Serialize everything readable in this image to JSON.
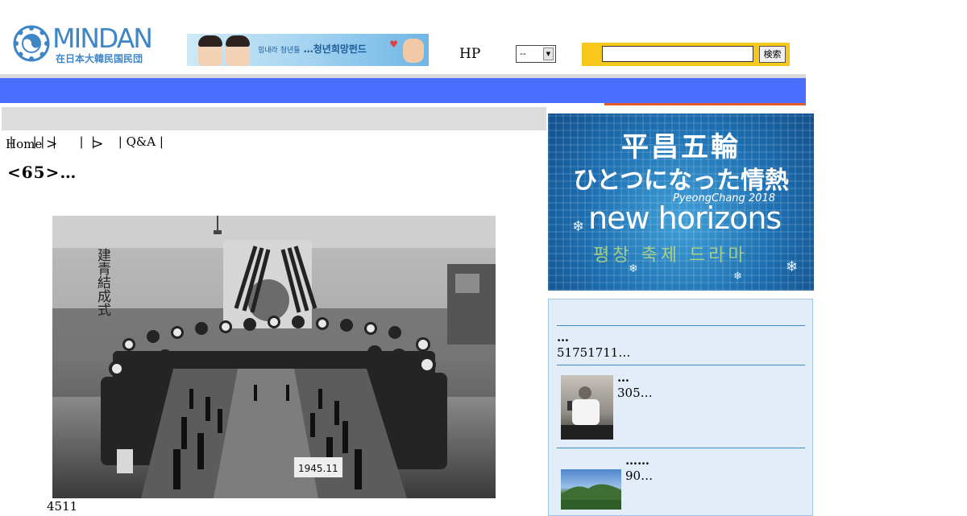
{
  "header": {
    "logo_text": "MINDAN",
    "logo_subtext": "在日本大韓民国民団",
    "banner_slogan_small": "힘내라 청년들",
    "banner_slogan": "…청년희망펀드",
    "hp_label": "HP",
    "hp_select_value": "--",
    "search_value": "",
    "search_button": "検索"
  },
  "submenu": {
    "text": "|     | |  |      |  |      | Q&A |"
  },
  "breadcrumb": {
    "home": "Home",
    "sep1": ">",
    "sep2": ">"
  },
  "article": {
    "title": "<65>…",
    "photo_sign": "1945.11",
    "photo_wall_text": "建青結成式",
    "caption": "4511"
  },
  "sidebar": {
    "banner_line1": "平昌五輪",
    "banner_line2": "ひとつになった情熱",
    "banner_event": "PyeongChang 2018",
    "banner_slogan": "new horizons",
    "banner_korean": "평창 축제 드라마",
    "news": [
      {
        "title": "…",
        "desc": "51751711…"
      },
      {
        "title": "…",
        "desc": "305…"
      },
      {
        "title": "……",
        "desc": "90…"
      }
    ]
  }
}
